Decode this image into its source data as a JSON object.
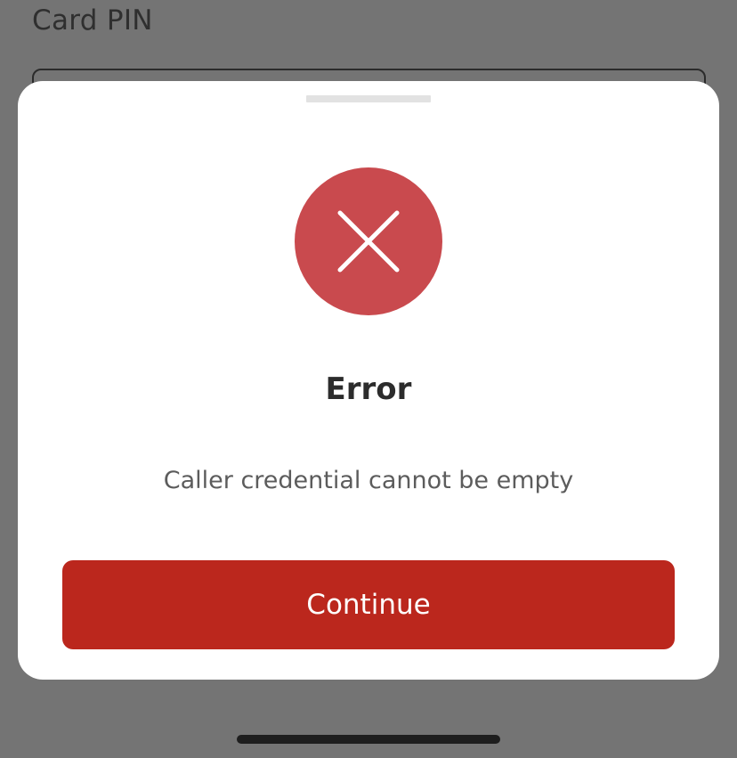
{
  "background": {
    "field_label": "Card PIN"
  },
  "dialog": {
    "status_icon": "x-close-icon",
    "title": "Error",
    "message": "Caller credential cannot be empty",
    "continue_label": "Continue"
  },
  "colors": {
    "overlay": "#747474",
    "error_badge": "#c94a4e",
    "primary_button": "#bb271d"
  }
}
